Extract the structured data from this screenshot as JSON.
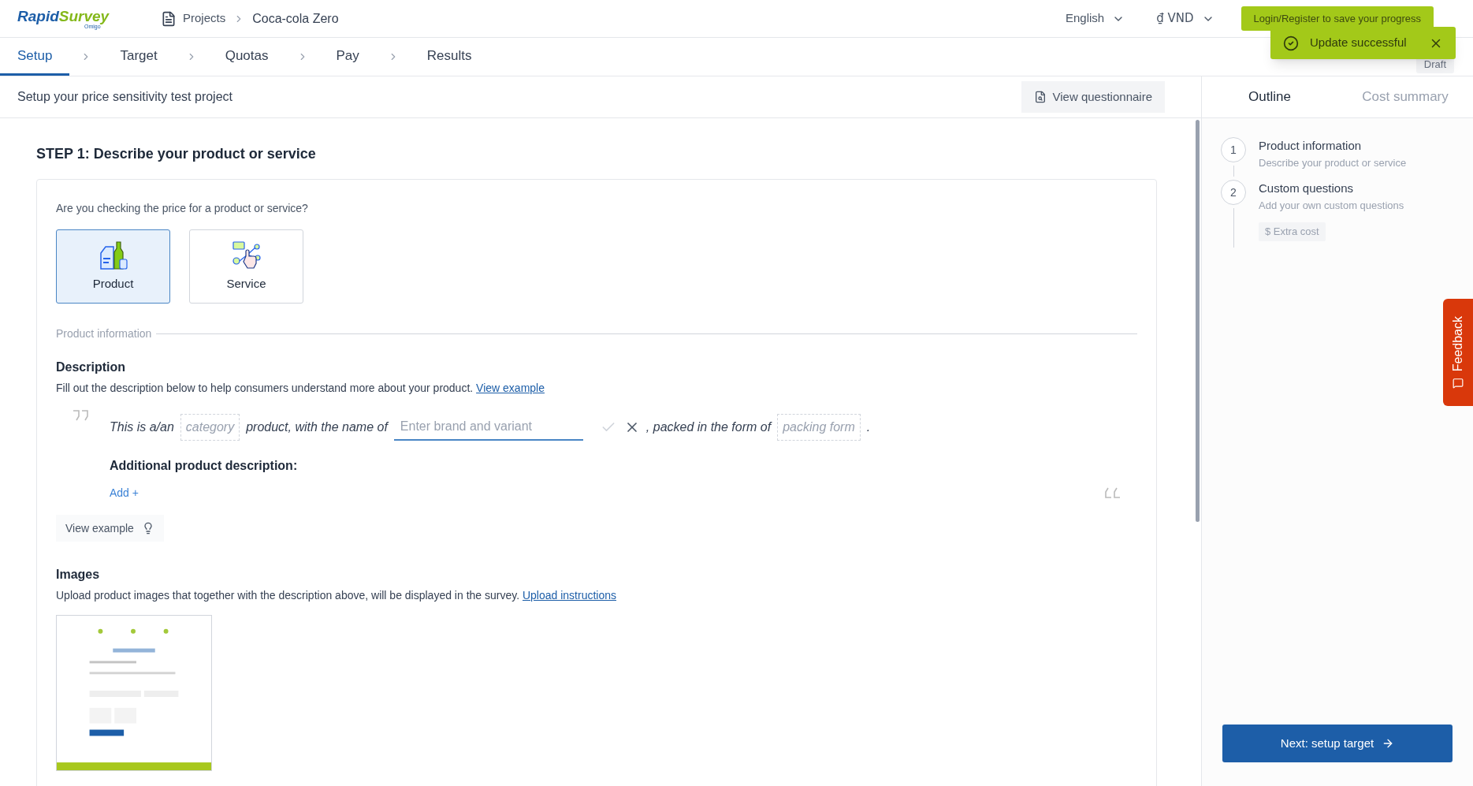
{
  "header": {
    "logo": {
      "parts": [
        "Rapid",
        "Survey"
      ],
      "tagline": "Omigo"
    },
    "breadcrumb": [
      "Projects",
      "Coca-cola Zero"
    ],
    "language": "English",
    "currency": "₫ VND",
    "login_button": "Login/Register to save your progress"
  },
  "toast": {
    "message": "Update successful"
  },
  "steps": [
    {
      "label": "Setup",
      "selected": true
    },
    {
      "label": "Target",
      "selected": false
    },
    {
      "label": "Quotas",
      "selected": false
    },
    {
      "label": "Pay",
      "selected": false
    },
    {
      "label": "Results",
      "selected": false
    }
  ],
  "status_badge": "Draft",
  "page_title": "Setup your price sensitivity test project",
  "view_questionnaire": "View questionnaire",
  "side_tabs": [
    {
      "label": "Outline",
      "selected": true
    },
    {
      "label": "Cost summary",
      "selected": false
    }
  ],
  "step_title": "STEP 1: Describe your product or service",
  "question": "Are you checking the price for a product or service?",
  "options": [
    {
      "kind": "product",
      "label": "Product",
      "selected": true
    },
    {
      "kind": "service",
      "label": "Service",
      "selected": false
    }
  ],
  "section_label": "Product information",
  "description": {
    "heading": "Description",
    "text": "Fill out the description below to help consumers understand more about your product.",
    "link": "View example",
    "sentence": [
      {
        "kind": "text",
        "text": "This is a/an"
      },
      {
        "kind": "slot",
        "placeholder": "category"
      },
      {
        "kind": "text",
        "text": "product, with the name of"
      },
      {
        "kind": "input",
        "placeholder": "Enter brand and variant"
      },
      {
        "kind": "text",
        "text": ", packed in the form of"
      },
      {
        "kind": "slot",
        "placeholder": "packing form"
      },
      {
        "kind": "text",
        "text": "."
      }
    ],
    "additional_heading": "Additional product description:",
    "add_link": "Add +"
  },
  "view_example_button": "View example",
  "images": {
    "heading": "Images",
    "text": "Upload product images that together with the description above, will be displayed in the survey.",
    "link": "Upload instructions"
  },
  "outline": [
    {
      "number": "1",
      "title": "Product information",
      "subtitle": "Describe your product or service"
    },
    {
      "number": "2",
      "title": "Custom questions",
      "subtitle": "Add your own custom questions",
      "tag": "$ Extra cost"
    }
  ],
  "next_button": "Next: setup target",
  "feedback": "Feedback"
}
